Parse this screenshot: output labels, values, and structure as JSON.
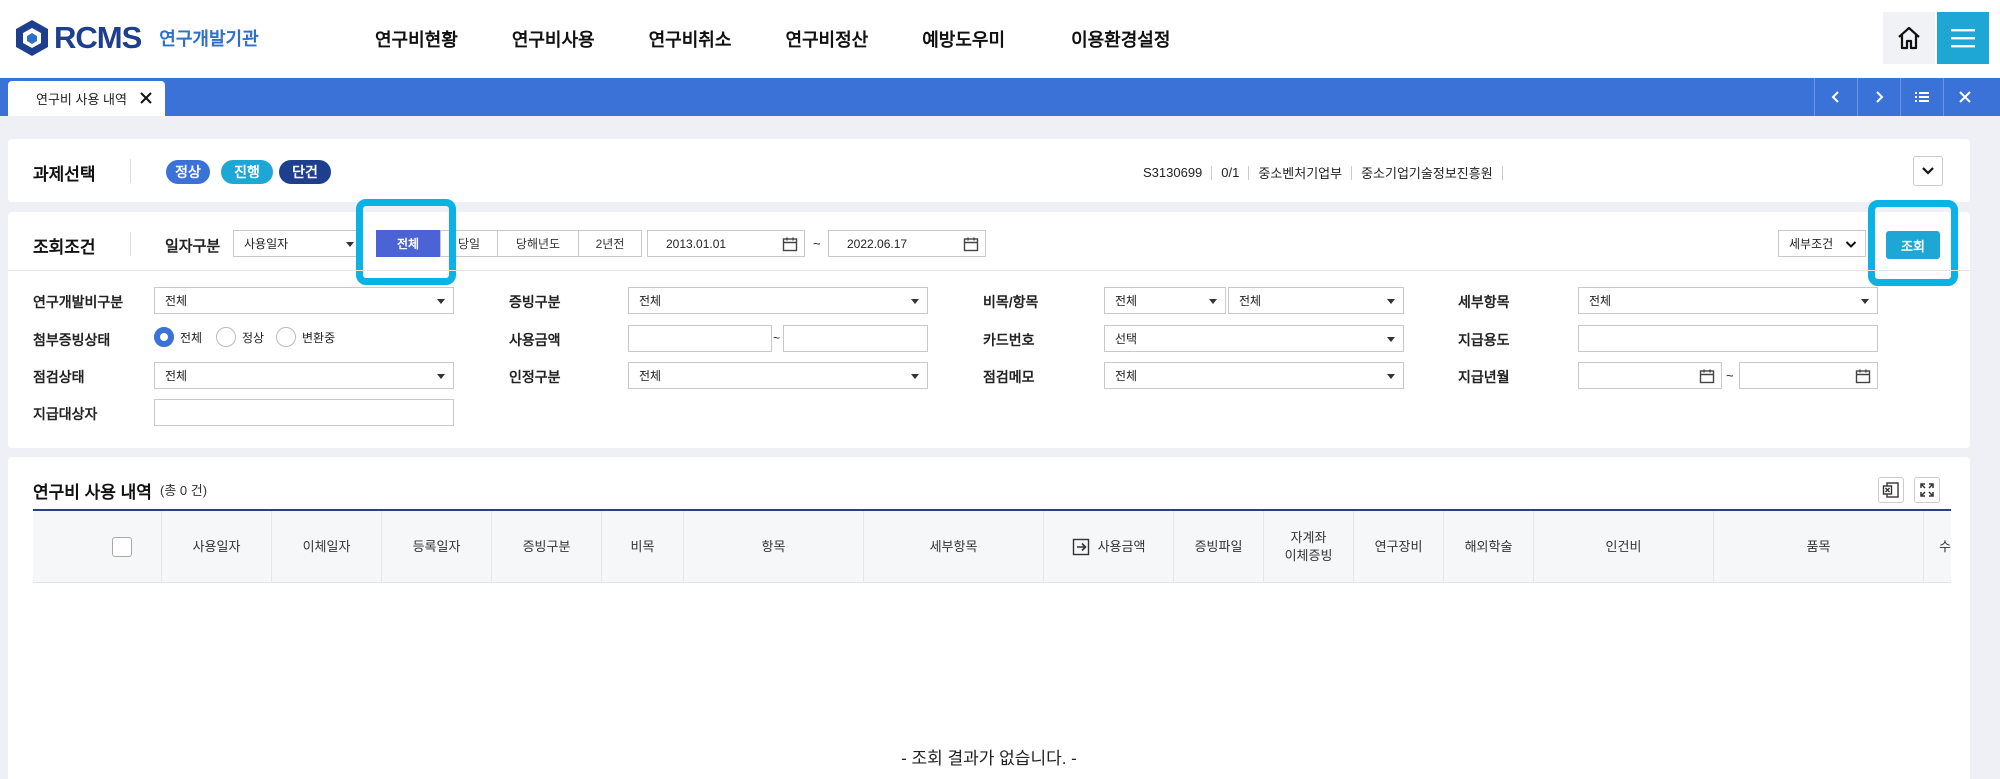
{
  "header": {
    "logo_text": "RCMS",
    "logo_sub": "연구개발기관",
    "nav": [
      "연구비현황",
      "연구비사용",
      "연구비취소",
      "연구비정산",
      "예방도우미",
      "이용환경설정"
    ],
    "home_icon": "home-icon",
    "menu_icon": "hamburger-menu-icon"
  },
  "tabbar": {
    "tab_label": "연구비 사용 내역",
    "controls": [
      "chevron-left-icon",
      "chevron-right-icon",
      "list-icon",
      "close-icon"
    ]
  },
  "project": {
    "title": "과제선택",
    "status_pills": [
      {
        "label": "정상",
        "color": "#3a72d8"
      },
      {
        "label": "진행",
        "color": "#1ea7d4"
      },
      {
        "label": "단건",
        "color": "#1e3f8e"
      }
    ],
    "info": [
      "S3130699",
      "0/1",
      "중소벤처기업부",
      "중소기업기술정보진흥원"
    ]
  },
  "query": {
    "title": "조회조건",
    "date_type_label": "일자구분",
    "date_type_value": "사용일자",
    "period_buttons": [
      "전체",
      "당일",
      "당해년도",
      "2년전"
    ],
    "period_active": "전체",
    "date_from": "2013.01.01",
    "date_sep": "~",
    "date_to": "2022.06.17",
    "detail_select": "세부조건",
    "search_button": "조회",
    "fields": {
      "rnd_type_label": "연구개발비구분",
      "rnd_type_value": "전체",
      "evidence_type_label": "증빙구분",
      "evidence_type_value": "전체",
      "budget_label": "비목/항목",
      "budget_value1": "전체",
      "budget_value2": "전체",
      "detail_item_label": "세부항목",
      "detail_item_value": "전체",
      "attach_status_label": "첨부증빙상태",
      "attach_options": [
        "전체",
        "정상",
        "변환중"
      ],
      "attach_selected": "전체",
      "amount_label": "사용금액",
      "amount_from": "",
      "amount_to": "",
      "amount_sep": "~",
      "card_label": "카드번호",
      "card_value": "선택",
      "pay_purpose_label": "지급용도",
      "pay_purpose_value": "",
      "check_status_label": "점검상태",
      "check_status_value": "전체",
      "approval_label": "인정구분",
      "approval_value": "전체",
      "check_memo_label": "점검메모",
      "check_memo_value": "전체",
      "pay_month_label": "지급년월",
      "pay_month_sep": "~",
      "payee_label": "지급대상자",
      "payee_value": ""
    }
  },
  "result": {
    "title": "연구비 사용 내역",
    "count_text": "(총 0 건)",
    "columns": [
      "사용일자",
      "이체일자",
      "등록일자",
      "증빙구분",
      "비목",
      "항목",
      "세부항목",
      "사용금액",
      "증빙파일",
      "자계좌\n이체증빙",
      "연구장비",
      "해외학술",
      "인건비",
      "품목",
      "수"
    ],
    "empty_message": "- 조회 결과가 없습니다. -",
    "excel_icon": "excel-icon",
    "expand_icon": "expand-icon"
  }
}
